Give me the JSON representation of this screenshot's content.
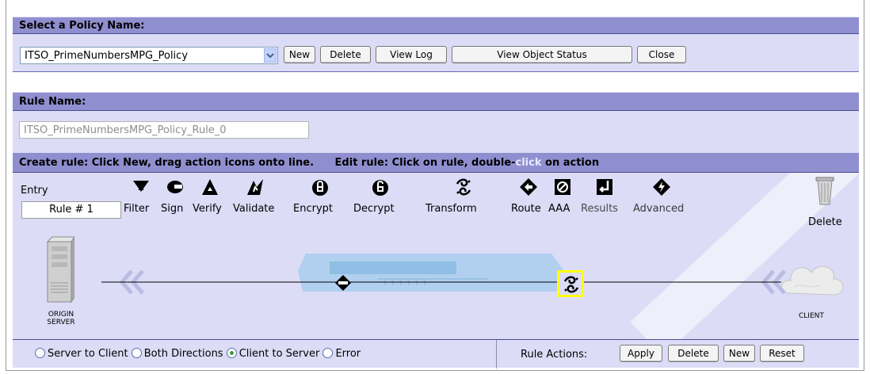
{
  "policy_section": {
    "header": "Select a Policy Name:",
    "selected_policy": "ITSO_PrimeNumbersMPG_Policy",
    "buttons": {
      "new": "New",
      "delete": "Delete",
      "view_log": "View Log",
      "view_object_status": "View Object Status",
      "close": "Close"
    }
  },
  "rule_section": {
    "header": "Rule Name:",
    "rule_name_value": "ITSO_PrimeNumbersMPG_Policy_Rule_0",
    "instructions_create": "Create rule: Click New, drag action icons onto line.",
    "instructions_edit_prefix": "Edit rule: Click on rule, double-",
    "instructions_edit_link": "click",
    "instructions_edit_suffix": " on action"
  },
  "toolbar": {
    "entry_label": "Entry",
    "rule_number": "Rule # 1",
    "actions": [
      {
        "label": "Filter",
        "icon": "filter-icon"
      },
      {
        "label": "Sign",
        "icon": "sign-icon"
      },
      {
        "label": "Verify",
        "icon": "verify-icon"
      },
      {
        "label": "Validate",
        "icon": "validate-icon"
      },
      {
        "label": "Encrypt",
        "icon": "encrypt-icon"
      },
      {
        "label": "Decrypt",
        "icon": "decrypt-icon"
      },
      {
        "label": "Transform",
        "icon": "transform-icon"
      },
      {
        "label": "Route",
        "icon": "route-icon"
      },
      {
        "label": "AAA",
        "icon": "aaa-icon"
      },
      {
        "label": "Results",
        "icon": "results-icon"
      },
      {
        "label": "Advanced",
        "icon": "advanced-icon"
      }
    ],
    "delete_label": "Delete"
  },
  "canvas": {
    "origin_label_1": "ORIGIN",
    "origin_label_2": "SERVER",
    "client_label": "CLIENT"
  },
  "direction": {
    "options": [
      "Server to Client",
      "Both Directions",
      "Client to Server",
      "Error"
    ],
    "selected": "Client to Server"
  },
  "rule_actions": {
    "label": "Rule Actions:",
    "apply": "Apply",
    "delete": "Delete",
    "new": "New",
    "reset": "Reset"
  },
  "colors": {
    "header_bg": "#8f8fd0",
    "pane_bg": "#dcdcf7",
    "highlight": "#ffff00"
  }
}
